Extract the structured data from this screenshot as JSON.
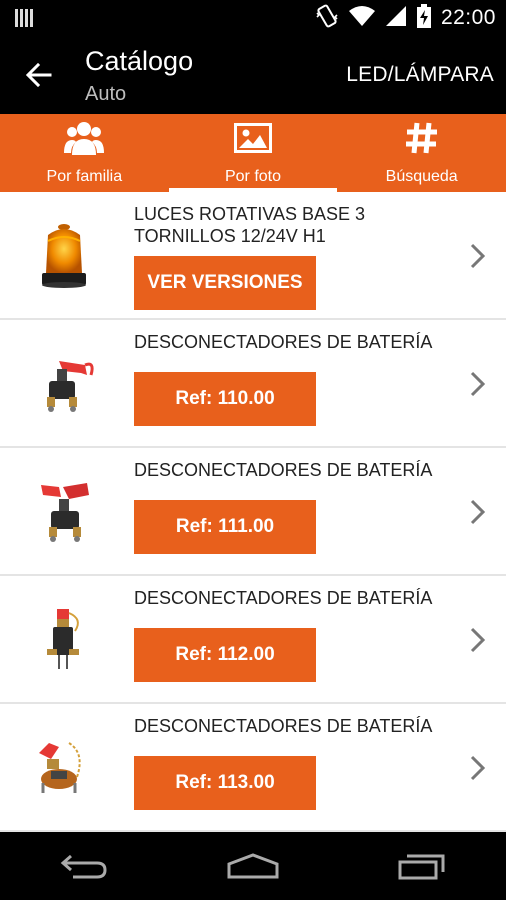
{
  "status_bar": {
    "time": "22:00"
  },
  "app_bar": {
    "title": "Catálogo",
    "subtitle": "Auto",
    "action": "LED/LÁMPARA"
  },
  "tabs": [
    {
      "label": "Por familia",
      "icon": "people-icon",
      "active": false
    },
    {
      "label": "Por foto",
      "icon": "image-icon",
      "active": true
    },
    {
      "label": "Búsqueda",
      "icon": "hash-icon",
      "active": false
    }
  ],
  "items": [
    {
      "title": "LUCES ROTATIVAS BASE 3 TORNILLOS 12/24V H1",
      "button": "VER VERSIONES",
      "image": "rotating-beacon-icon"
    },
    {
      "title": "DESCONECTADORES DE BATERÍA",
      "button": "Ref: 110.00",
      "image": "battery-disconnector-icon"
    },
    {
      "title": "DESCONECTADORES DE BATERÍA",
      "button": "Ref: 111.00",
      "image": "battery-disconnector-icon"
    },
    {
      "title": "DESCONECTADORES DE BATERÍA",
      "button": "Ref: 112.00",
      "image": "battery-disconnector-icon"
    },
    {
      "title": "DESCONECTADORES DE BATERÍA",
      "button": "Ref: 113.00",
      "image": "battery-disconnector-icon"
    }
  ],
  "colors": {
    "accent": "#e8601c",
    "bar": "#000000"
  }
}
